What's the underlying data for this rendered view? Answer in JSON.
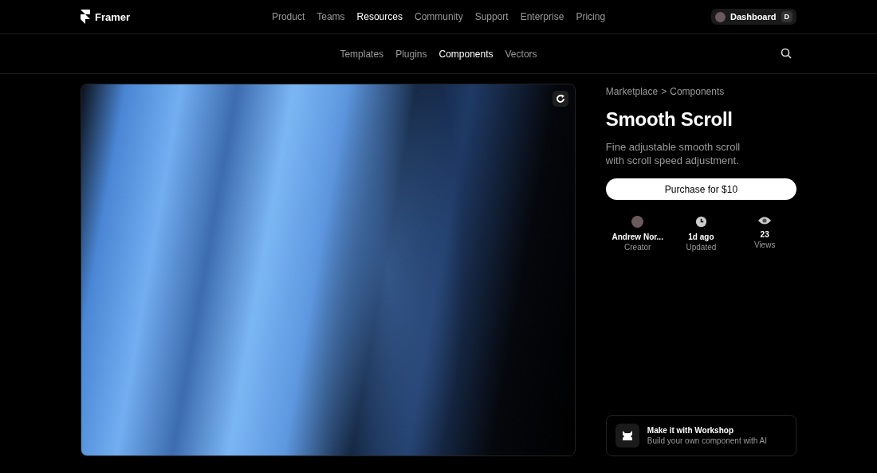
{
  "brand": {
    "name": "Framer"
  },
  "nav": [
    {
      "label": "Product",
      "selected": false
    },
    {
      "label": "Teams",
      "selected": false
    },
    {
      "label": "Resources",
      "selected": true
    },
    {
      "label": "Community",
      "selected": false
    },
    {
      "label": "Support",
      "selected": false
    },
    {
      "label": "Enterprise",
      "selected": false
    },
    {
      "label": "Pricing",
      "selected": false
    }
  ],
  "dashboard": {
    "label": "Dashboard",
    "key": "D"
  },
  "subnav": [
    {
      "label": "Templates",
      "selected": false
    },
    {
      "label": "Plugins",
      "selected": false
    },
    {
      "label": "Components",
      "selected": true
    },
    {
      "label": "Vectors",
      "selected": false
    }
  ],
  "breadcrumb": [
    "Marketplace",
    "Components"
  ],
  "breadcrumb_separator": ">",
  "title": "Smooth Scroll",
  "description": "Fine adjustable smooth scroll with scroll speed adjustment.",
  "purchase_button": "Purchase for $10",
  "stats": [
    {
      "kind": "avatar",
      "value": "Andrew Nor...",
      "label": "Creator"
    },
    {
      "kind": "clock",
      "value": "1d ago",
      "label": "Updated"
    },
    {
      "kind": "eye",
      "value": "23",
      "label": "Views"
    }
  ],
  "workshop": {
    "title": "Make it with Workshop",
    "subtitle": "Build your own component with AI"
  }
}
